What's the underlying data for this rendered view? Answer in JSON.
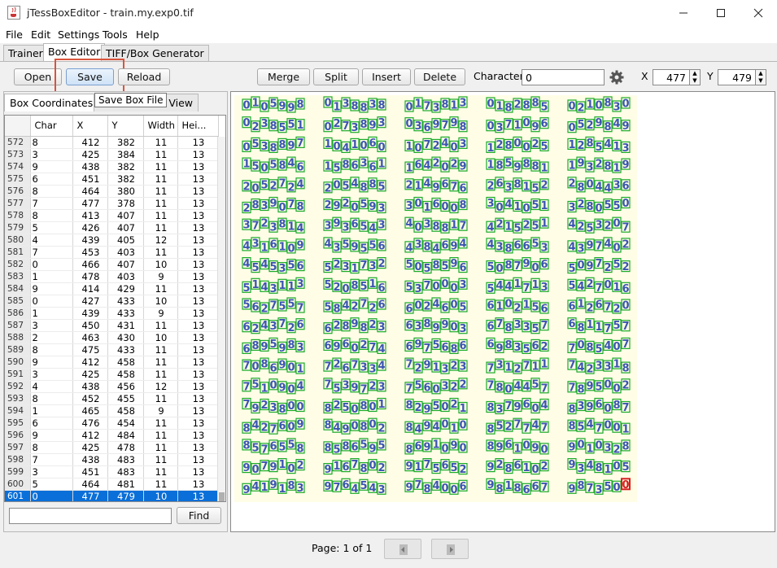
{
  "window": {
    "title": "jTessBoxEditor - train.my.exp0.tif"
  },
  "menu": [
    "File",
    "Edit",
    "Settings",
    "Tools",
    "Help"
  ],
  "tabs": [
    "Trainer",
    "Box Editor",
    "TIFF/Box Generator"
  ],
  "toolbar": {
    "open": "Open",
    "save": "Save",
    "reload": "Reload",
    "merge": "Merge",
    "split": "Split",
    "insert": "Insert",
    "delete": "Delete",
    "character_label": "Character",
    "character_value": "0",
    "x_label": "X",
    "x_value": "477",
    "y_label": "Y",
    "y_value": "479",
    "save_tooltip": "Save Box File"
  },
  "left_tabs": {
    "coords": "Box Coordinates",
    "view": "x View"
  },
  "table": {
    "headers": [
      "Char",
      "X",
      "Y",
      "Width",
      "Hei..."
    ],
    "rows": [
      [
        "572",
        "8",
        "412",
        "382",
        "11",
        "13"
      ],
      [
        "573",
        "3",
        "425",
        "384",
        "11",
        "13"
      ],
      [
        "574",
        "9",
        "438",
        "382",
        "11",
        "13"
      ],
      [
        "575",
        "6",
        "451",
        "382",
        "11",
        "13"
      ],
      [
        "576",
        "8",
        "464",
        "380",
        "11",
        "13"
      ],
      [
        "577",
        "7",
        "477",
        "378",
        "11",
        "13"
      ],
      [
        "578",
        "8",
        "413",
        "407",
        "11",
        "13"
      ],
      [
        "579",
        "5",
        "426",
        "407",
        "11",
        "13"
      ],
      [
        "580",
        "4",
        "439",
        "405",
        "12",
        "13"
      ],
      [
        "581",
        "7",
        "453",
        "403",
        "11",
        "13"
      ],
      [
        "582",
        "0",
        "466",
        "407",
        "10",
        "13"
      ],
      [
        "583",
        "1",
        "478",
        "403",
        "9",
        "13"
      ],
      [
        "584",
        "9",
        "414",
        "429",
        "11",
        "13"
      ],
      [
        "585",
        "0",
        "427",
        "433",
        "10",
        "13"
      ],
      [
        "586",
        "1",
        "439",
        "433",
        "9",
        "13"
      ],
      [
        "587",
        "3",
        "450",
        "431",
        "11",
        "13"
      ],
      [
        "588",
        "2",
        "463",
        "430",
        "10",
        "13"
      ],
      [
        "589",
        "8",
        "475",
        "433",
        "11",
        "13"
      ],
      [
        "590",
        "9",
        "412",
        "458",
        "11",
        "13"
      ],
      [
        "591",
        "3",
        "425",
        "458",
        "11",
        "13"
      ],
      [
        "592",
        "4",
        "438",
        "456",
        "12",
        "13"
      ],
      [
        "593",
        "8",
        "452",
        "455",
        "11",
        "13"
      ],
      [
        "594",
        "1",
        "465",
        "458",
        "9",
        "13"
      ],
      [
        "595",
        "6",
        "476",
        "454",
        "11",
        "13"
      ],
      [
        "596",
        "9",
        "412",
        "484",
        "11",
        "13"
      ],
      [
        "597",
        "8",
        "425",
        "478",
        "11",
        "13"
      ],
      [
        "598",
        "7",
        "438",
        "483",
        "11",
        "13"
      ],
      [
        "599",
        "3",
        "451",
        "483",
        "11",
        "13"
      ],
      [
        "600",
        "5",
        "464",
        "481",
        "11",
        "13"
      ],
      [
        "601",
        "0",
        "477",
        "479",
        "10",
        "13"
      ]
    ],
    "selected_row": "601"
  },
  "find": {
    "button": "Find",
    "value": ""
  },
  "image_rows": [
    [
      "0105998",
      "0138838",
      "0173813",
      "0182885",
      "0210830"
    ],
    [
      "0238551",
      "0273893",
      "0369798",
      "0371096",
      "0529849"
    ],
    [
      "0538897",
      "1041060",
      "1072403",
      "1280025",
      "1285413"
    ],
    [
      "1505846",
      "1586361",
      "1642029",
      "1859881",
      "1932819"
    ],
    [
      "2052724",
      "2054885",
      "2149676",
      "2638152",
      "2804436"
    ],
    [
      "2839078",
      "2920593",
      "3016008",
      "3041051",
      "3280550"
    ],
    [
      "3723814",
      "3936543",
      "4038817",
      "4215251",
      "4253207"
    ],
    [
      "4316109",
      "4359556",
      "4384694",
      "4386653",
      "4397402"
    ],
    [
      "4545356",
      "5231732",
      "5058596",
      "5087906",
      "5097252"
    ],
    [
      "5143113",
      "5208516",
      "5370003",
      "5441713",
      "5427016"
    ],
    [
      "5627557",
      "5842726",
      "6024605",
      "6102156",
      "6126720"
    ],
    [
      "6243726",
      "6289823",
      "6389903",
      "6783357",
      "6811757"
    ],
    [
      "6895983",
      "6960274",
      "6975686",
      "6983562",
      "7085407"
    ],
    [
      "7086901",
      "7267334",
      "7291323",
      "7312711",
      "7423318"
    ],
    [
      "7510904",
      "7539723",
      "7560322",
      "7804457",
      "7895002"
    ],
    [
      "7923800",
      "8250801",
      "8295021",
      "8379604",
      "8396087"
    ],
    [
      "8427609",
      "8490802",
      "8494010",
      "8527747",
      "8547001"
    ],
    [
      "8576558",
      "8586595",
      "8691090",
      "8961090",
      "9010328"
    ],
    [
      "9079102",
      "9167802",
      "9175652",
      "9286102",
      "9348105"
    ],
    [
      "9419183",
      "9764543",
      "9784006",
      "9818667",
      "9873500"
    ]
  ],
  "pager": {
    "text": "Page: 1 of 1"
  },
  "colors": {
    "digit": "#3a54b2",
    "box": "#1aaa2a",
    "selected_box": "#d42020",
    "image_bg": "#fffde6",
    "selection": "#0a6fd8"
  }
}
